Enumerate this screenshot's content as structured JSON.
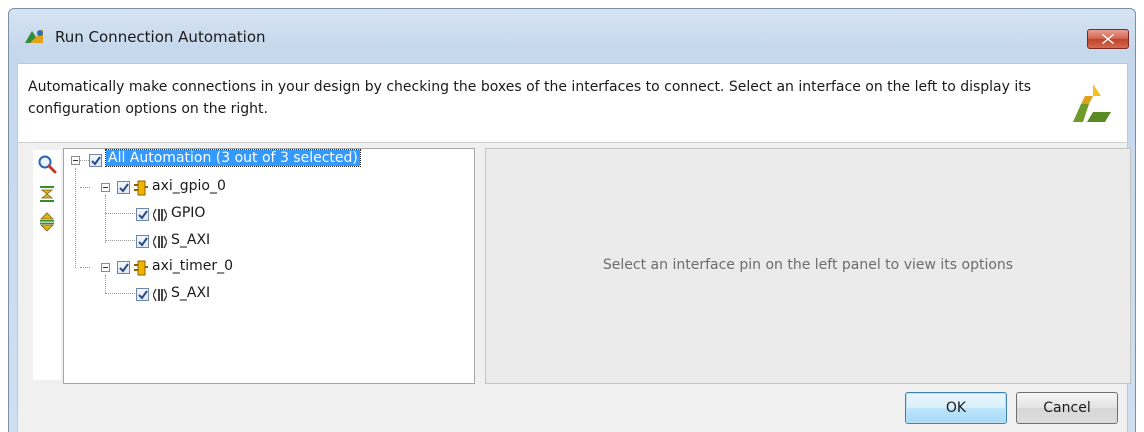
{
  "window": {
    "title": "Run Connection Automation",
    "title_icon": "connection-automation-icon",
    "close_icon": "close-icon"
  },
  "description": "Automatically make connections in your design by checking the boxes of the interfaces to connect. Select an interface on the left to display its configuration options on the right.",
  "toolbar": {
    "items": [
      "search-icon",
      "collapse-all-icon",
      "expand-all-icon"
    ]
  },
  "tree": {
    "root": {
      "label": "All Automation (3 out of 3 selected)",
      "checked": true,
      "selected": true
    },
    "nodes": [
      {
        "label": "axi_gpio_0",
        "icon": "ip-block-icon",
        "checked": true,
        "children": [
          {
            "label": "GPIO",
            "icon": "interface-icon",
            "checked": true
          },
          {
            "label": "S_AXI",
            "icon": "interface-icon",
            "checked": true
          }
        ]
      },
      {
        "label": "axi_timer_0",
        "icon": "ip-block-icon",
        "checked": true,
        "children": [
          {
            "label": "S_AXI",
            "icon": "interface-icon",
            "checked": true
          }
        ]
      }
    ]
  },
  "options_panel": {
    "placeholder": "Select an interface pin on the left panel to view its options"
  },
  "buttons": {
    "ok": "OK",
    "cancel": "Cancel"
  },
  "colors": {
    "selection": "#3399ff",
    "close_button": "#c9503a",
    "ip_icon": "#f0b400"
  }
}
